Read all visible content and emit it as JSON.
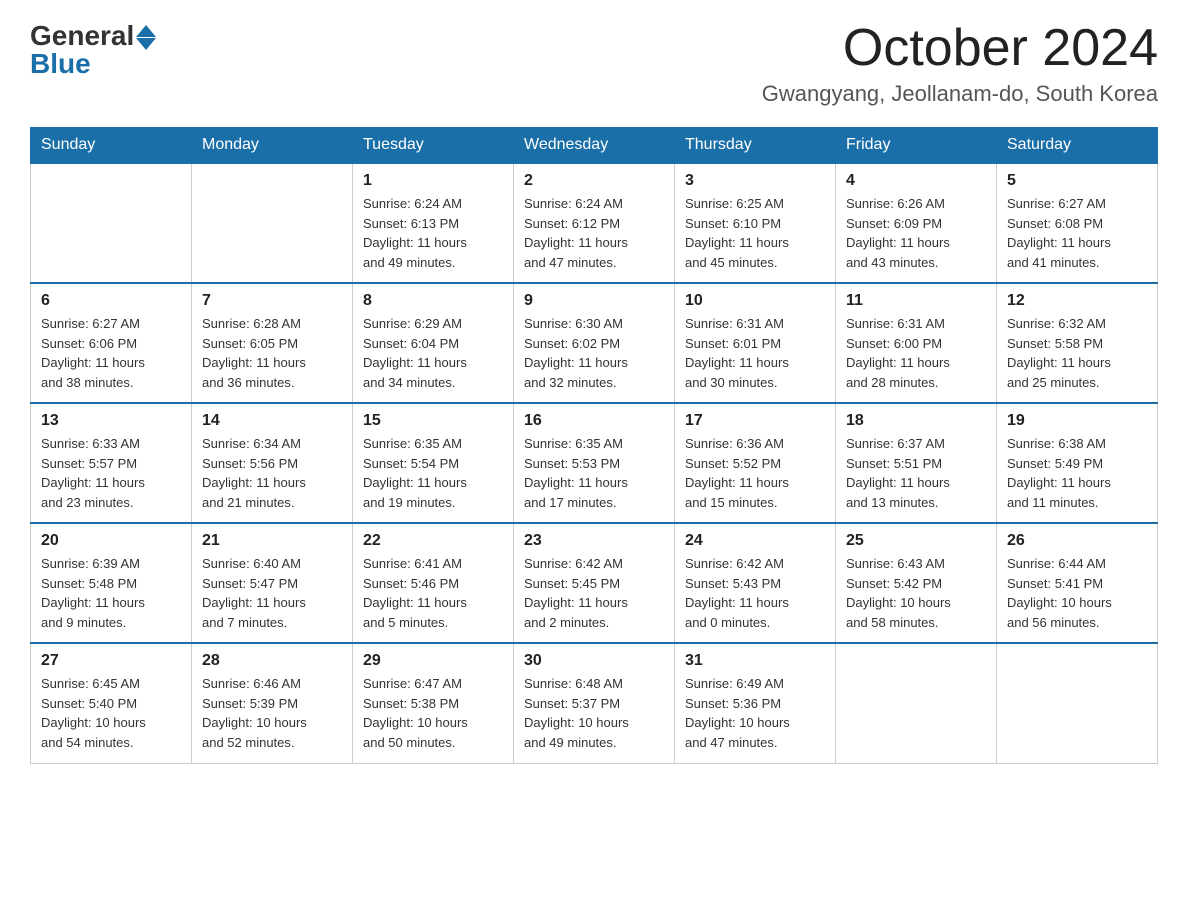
{
  "logo": {
    "text_general": "General",
    "text_blue": "Blue"
  },
  "header": {
    "month_year": "October 2024",
    "location": "Gwangyang, Jeollanam-do, South Korea"
  },
  "weekdays": [
    "Sunday",
    "Monday",
    "Tuesday",
    "Wednesday",
    "Thursday",
    "Friday",
    "Saturday"
  ],
  "weeks": [
    [
      {
        "day": "",
        "info": ""
      },
      {
        "day": "",
        "info": ""
      },
      {
        "day": "1",
        "info": "Sunrise: 6:24 AM\nSunset: 6:13 PM\nDaylight: 11 hours\nand 49 minutes."
      },
      {
        "day": "2",
        "info": "Sunrise: 6:24 AM\nSunset: 6:12 PM\nDaylight: 11 hours\nand 47 minutes."
      },
      {
        "day": "3",
        "info": "Sunrise: 6:25 AM\nSunset: 6:10 PM\nDaylight: 11 hours\nand 45 minutes."
      },
      {
        "day": "4",
        "info": "Sunrise: 6:26 AM\nSunset: 6:09 PM\nDaylight: 11 hours\nand 43 minutes."
      },
      {
        "day": "5",
        "info": "Sunrise: 6:27 AM\nSunset: 6:08 PM\nDaylight: 11 hours\nand 41 minutes."
      }
    ],
    [
      {
        "day": "6",
        "info": "Sunrise: 6:27 AM\nSunset: 6:06 PM\nDaylight: 11 hours\nand 38 minutes."
      },
      {
        "day": "7",
        "info": "Sunrise: 6:28 AM\nSunset: 6:05 PM\nDaylight: 11 hours\nand 36 minutes."
      },
      {
        "day": "8",
        "info": "Sunrise: 6:29 AM\nSunset: 6:04 PM\nDaylight: 11 hours\nand 34 minutes."
      },
      {
        "day": "9",
        "info": "Sunrise: 6:30 AM\nSunset: 6:02 PM\nDaylight: 11 hours\nand 32 minutes."
      },
      {
        "day": "10",
        "info": "Sunrise: 6:31 AM\nSunset: 6:01 PM\nDaylight: 11 hours\nand 30 minutes."
      },
      {
        "day": "11",
        "info": "Sunrise: 6:31 AM\nSunset: 6:00 PM\nDaylight: 11 hours\nand 28 minutes."
      },
      {
        "day": "12",
        "info": "Sunrise: 6:32 AM\nSunset: 5:58 PM\nDaylight: 11 hours\nand 25 minutes."
      }
    ],
    [
      {
        "day": "13",
        "info": "Sunrise: 6:33 AM\nSunset: 5:57 PM\nDaylight: 11 hours\nand 23 minutes."
      },
      {
        "day": "14",
        "info": "Sunrise: 6:34 AM\nSunset: 5:56 PM\nDaylight: 11 hours\nand 21 minutes."
      },
      {
        "day": "15",
        "info": "Sunrise: 6:35 AM\nSunset: 5:54 PM\nDaylight: 11 hours\nand 19 minutes."
      },
      {
        "day": "16",
        "info": "Sunrise: 6:35 AM\nSunset: 5:53 PM\nDaylight: 11 hours\nand 17 minutes."
      },
      {
        "day": "17",
        "info": "Sunrise: 6:36 AM\nSunset: 5:52 PM\nDaylight: 11 hours\nand 15 minutes."
      },
      {
        "day": "18",
        "info": "Sunrise: 6:37 AM\nSunset: 5:51 PM\nDaylight: 11 hours\nand 13 minutes."
      },
      {
        "day": "19",
        "info": "Sunrise: 6:38 AM\nSunset: 5:49 PM\nDaylight: 11 hours\nand 11 minutes."
      }
    ],
    [
      {
        "day": "20",
        "info": "Sunrise: 6:39 AM\nSunset: 5:48 PM\nDaylight: 11 hours\nand 9 minutes."
      },
      {
        "day": "21",
        "info": "Sunrise: 6:40 AM\nSunset: 5:47 PM\nDaylight: 11 hours\nand 7 minutes."
      },
      {
        "day": "22",
        "info": "Sunrise: 6:41 AM\nSunset: 5:46 PM\nDaylight: 11 hours\nand 5 minutes."
      },
      {
        "day": "23",
        "info": "Sunrise: 6:42 AM\nSunset: 5:45 PM\nDaylight: 11 hours\nand 2 minutes."
      },
      {
        "day": "24",
        "info": "Sunrise: 6:42 AM\nSunset: 5:43 PM\nDaylight: 11 hours\nand 0 minutes."
      },
      {
        "day": "25",
        "info": "Sunrise: 6:43 AM\nSunset: 5:42 PM\nDaylight: 10 hours\nand 58 minutes."
      },
      {
        "day": "26",
        "info": "Sunrise: 6:44 AM\nSunset: 5:41 PM\nDaylight: 10 hours\nand 56 minutes."
      }
    ],
    [
      {
        "day": "27",
        "info": "Sunrise: 6:45 AM\nSunset: 5:40 PM\nDaylight: 10 hours\nand 54 minutes."
      },
      {
        "day": "28",
        "info": "Sunrise: 6:46 AM\nSunset: 5:39 PM\nDaylight: 10 hours\nand 52 minutes."
      },
      {
        "day": "29",
        "info": "Sunrise: 6:47 AM\nSunset: 5:38 PM\nDaylight: 10 hours\nand 50 minutes."
      },
      {
        "day": "30",
        "info": "Sunrise: 6:48 AM\nSunset: 5:37 PM\nDaylight: 10 hours\nand 49 minutes."
      },
      {
        "day": "31",
        "info": "Sunrise: 6:49 AM\nSunset: 5:36 PM\nDaylight: 10 hours\nand 47 minutes."
      },
      {
        "day": "",
        "info": ""
      },
      {
        "day": "",
        "info": ""
      }
    ]
  ]
}
